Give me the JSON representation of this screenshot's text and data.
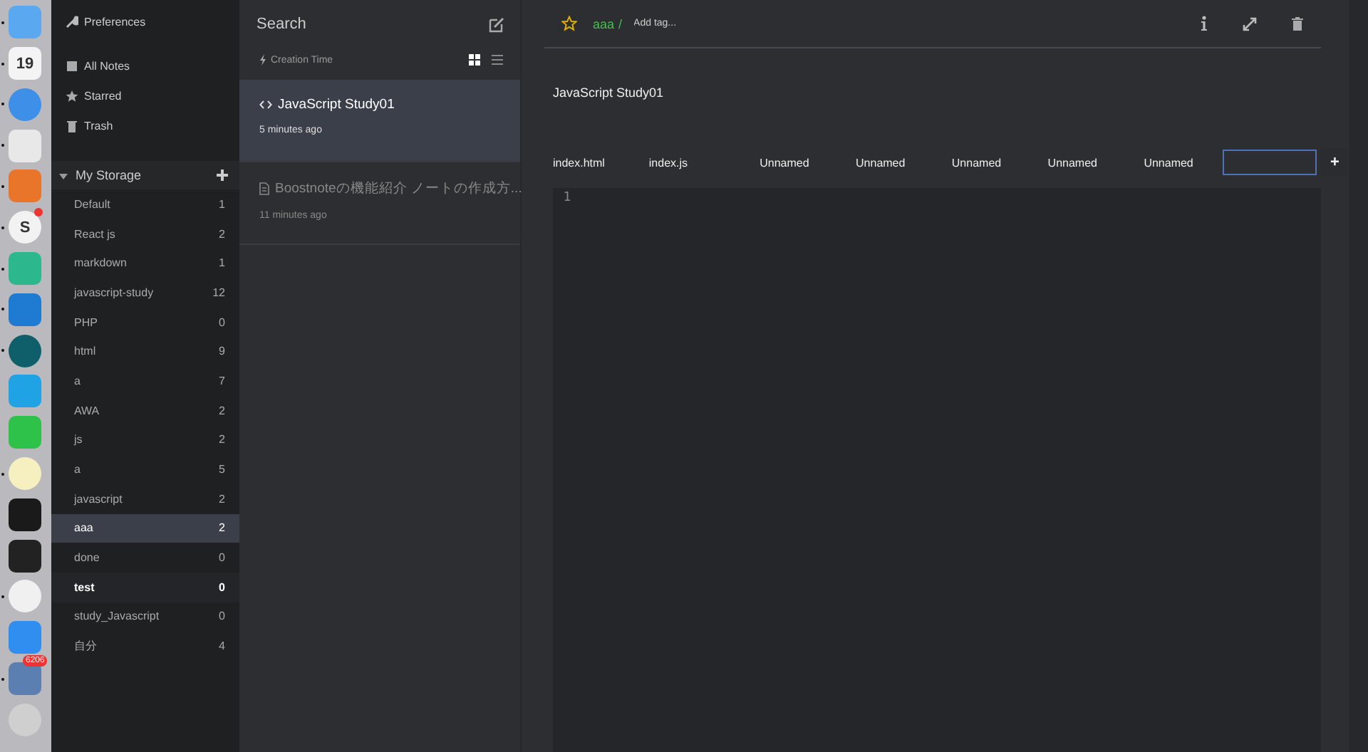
{
  "dock": {
    "apps": [
      {
        "running": true
      },
      {
        "running": true,
        "label": "19"
      },
      {
        "running": true
      },
      {
        "running": true
      },
      {
        "running": true
      },
      {
        "running": true,
        "label": "S",
        "alert": true
      },
      {
        "running": true
      },
      {
        "running": true
      },
      {
        "running": true
      },
      {
        "running": false
      },
      {
        "running": false
      },
      {
        "running": true
      },
      {
        "running": false
      },
      {
        "running": false
      },
      {
        "running": true
      },
      {
        "running": false
      },
      {
        "running": true,
        "badge": "6206"
      },
      {
        "running": false
      }
    ]
  },
  "sidebar": {
    "preferences": "Preferences",
    "nav": [
      {
        "kind": "notes",
        "label": "All Notes"
      },
      {
        "kind": "star",
        "label": "Starred"
      },
      {
        "kind": "trash",
        "label": "Trash"
      }
    ],
    "storage": {
      "name": "My Storage",
      "expanded": true,
      "folders": [
        {
          "name": "Default",
          "count": "1",
          "selected": false,
          "hover": false
        },
        {
          "name": "React js",
          "count": "2",
          "selected": false,
          "hover": false
        },
        {
          "name": "markdown",
          "count": "1",
          "selected": false,
          "hover": false
        },
        {
          "name": "javascript-study",
          "count": "12",
          "selected": false,
          "hover": false
        },
        {
          "name": "PHP",
          "count": "0",
          "selected": false,
          "hover": false
        },
        {
          "name": "html",
          "count": "9",
          "selected": false,
          "hover": false
        },
        {
          "name": "a",
          "count": "7",
          "selected": false,
          "hover": false
        },
        {
          "name": "AWA",
          "count": "2",
          "selected": false,
          "hover": false
        },
        {
          "name": "js",
          "count": "2",
          "selected": false,
          "hover": false
        },
        {
          "name": "a",
          "count": "5",
          "selected": false,
          "hover": false
        },
        {
          "name": "javascript",
          "count": "2",
          "selected": false,
          "hover": false
        },
        {
          "name": "aaa",
          "count": "2",
          "selected": true,
          "hover": false
        },
        {
          "name": "done",
          "count": "0",
          "selected": false,
          "hover": false
        },
        {
          "name": "test",
          "count": "0",
          "selected": false,
          "hover": true
        },
        {
          "name": "study_Javascript",
          "count": "0",
          "selected": false,
          "hover": false
        },
        {
          "name": "自分",
          "count": "4",
          "selected": false,
          "hover": false
        }
      ]
    }
  },
  "note_list": {
    "search": {
      "placeholder": "Search"
    },
    "sort": "Creation Time",
    "views": [
      {
        "kind": "grid",
        "selected": true
      },
      {
        "kind": "list",
        "selected": false
      }
    ],
    "notes": [
      {
        "kind": "snippet",
        "title": "JavaScript Study01",
        "time": "5 minutes ago",
        "selected": true
      },
      {
        "kind": "markdown",
        "title": "Boostnoteの機能紹介 ノートの作成方...",
        "time": "11 minutes ago",
        "selected": false
      }
    ]
  },
  "editor": {
    "starred": false,
    "folder": "aaa",
    "separator": "/",
    "tag_placeholder": "Add tag...",
    "title": "JavaScript Study01",
    "files": [
      {
        "kind": "tab",
        "name": "index.html"
      },
      {
        "kind": "tab",
        "name": "index.js"
      },
      {
        "kind": "tab",
        "name": "Unnamed"
      },
      {
        "kind": "tab",
        "name": "Unnamed"
      },
      {
        "kind": "tab",
        "name": "Unnamed"
      },
      {
        "kind": "tab",
        "name": "Unnamed"
      },
      {
        "kind": "tab",
        "name": "Unnamed"
      },
      {
        "kind": "rename"
      }
    ],
    "add_file": "+",
    "line_numbers": [
      "1"
    ]
  }
}
